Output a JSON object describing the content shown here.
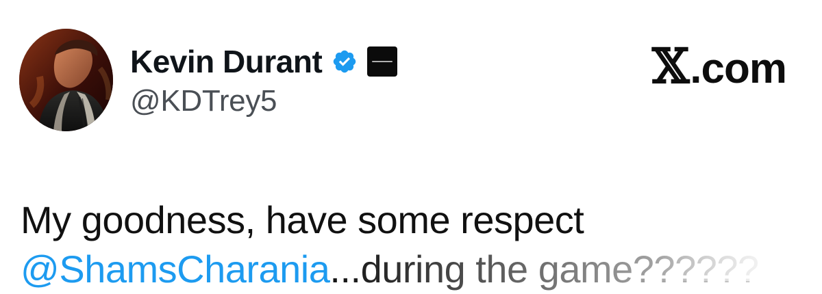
{
  "tweet": {
    "author": {
      "display_name": "Kevin Durant",
      "handle": "@KDTrey5",
      "avatar_icon": "profile-photo",
      "verified_icon": "verified-badge-icon",
      "verified_color": "#1d9bf0",
      "affiliate_icon": "affiliate-badge-icon"
    },
    "site": {
      "label": ".com",
      "logo_glyph": "𝕏"
    },
    "body": {
      "line1": "My goodness, have some respect",
      "mention": "@ShamsCharania",
      "line2_tail": "...during the game??????"
    },
    "colors": {
      "mention": "#1d9bf0",
      "text": "#111111",
      "handle": "#4a4f55"
    }
  }
}
